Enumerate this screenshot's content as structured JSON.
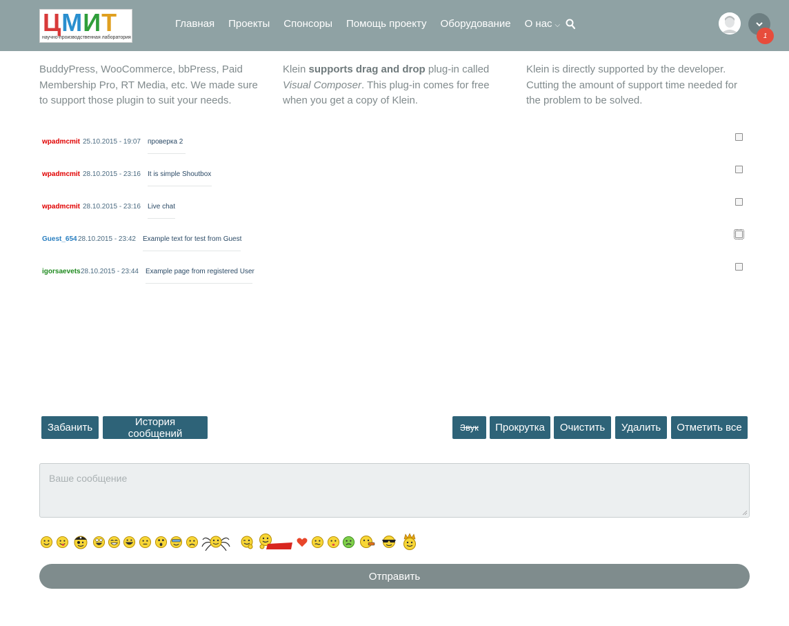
{
  "header": {
    "logo": {
      "letters": [
        "Ц",
        "М",
        "И",
        "Т"
      ],
      "subtitle": "научно-производственная лаборатория"
    },
    "nav": [
      {
        "label": "Главная"
      },
      {
        "label": "Проекты"
      },
      {
        "label": "Спонсоры"
      },
      {
        "label": "Помощь проекту"
      },
      {
        "label": "Оборудование"
      },
      {
        "label": "О нас",
        "has_dropdown": true
      }
    ],
    "notifications_count": "1",
    "icons": {
      "search": "search-icon",
      "dropdown": "chevron-down-icon",
      "avatar": "avatar"
    }
  },
  "features": {
    "col1": "BuddyPress, WooCommerce, bbPress, Paid Membership Pro, RT Media, etc. We made sure to support those plugin to suit your needs.",
    "col2_parts": [
      "Klein ",
      "supports drag and drop",
      " plug-in called ",
      "Visual Composer",
      ". This plug-in comes for free when you get a copy of Klein."
    ],
    "col3": "Klein is directly supported by the developer. Cutting the amount of support time needed for the problem to be solved."
  },
  "chat": {
    "messages": [
      {
        "user": "wpadmcmit",
        "role": "admin",
        "time": "25.10.2015 - 19:07",
        "text": "проверка 2"
      },
      {
        "user": "wpadmcmit",
        "role": "admin",
        "time": "28.10.2015 - 23:16",
        "text": "It is simple Shoutbox"
      },
      {
        "user": "wpadmcmit",
        "role": "admin",
        "time": "28.10.2015 - 23:16",
        "text": "Live chat"
      },
      {
        "user": "Guest_654",
        "role": "guest",
        "time": "28.10.2015 - 23:42",
        "text": "Example text for test from Guest"
      },
      {
        "user": "igorsaevets",
        "role": "user",
        "time": "28.10.2015 - 23:44",
        "text": "Example page from registered User"
      }
    ],
    "role_colors": {
      "admin": "#e00000",
      "guest": "#2a7fc0",
      "user": "#1f8a1f"
    }
  },
  "buttons": {
    "ban": "Забанить",
    "history": "История сообщений",
    "sound": "Звук",
    "scroll": "Прокрутка",
    "clear": "Очистить",
    "delete": "Удалить",
    "select_all": "Отметить все"
  },
  "input": {
    "placeholder": "Ваше сообщение"
  },
  "smileys": [
    "smile",
    "tongue",
    "pirate",
    "laugh",
    "grin",
    "big-grin",
    "surprised",
    "shocked",
    "cool",
    "sad",
    "spider",
    "wink",
    "hug",
    "heart",
    "neutral",
    "kiss",
    "sick",
    "whistle",
    "sunglasses",
    "king"
  ],
  "send_label": "Отправить",
  "colors": {
    "header": "#8fa2a4",
    "button": "#2e6378",
    "send": "#7f8c8d",
    "badge": "#e74c3c"
  }
}
